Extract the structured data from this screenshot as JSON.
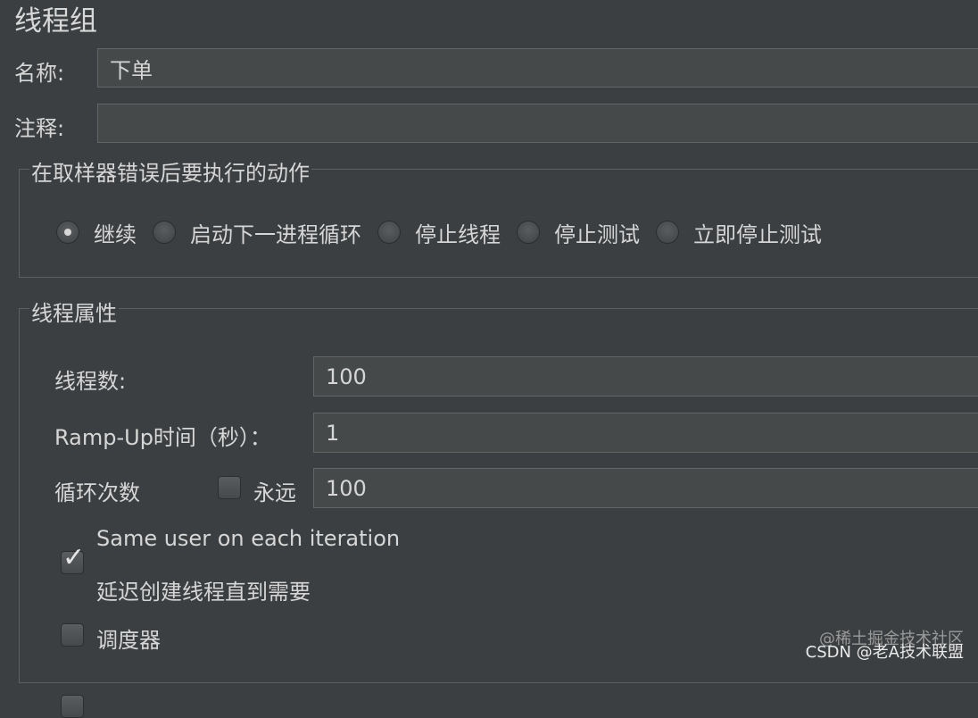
{
  "panel": {
    "title": "线程组",
    "name_label": "名称:",
    "name_value": "下单",
    "comment_label": "注释:",
    "comment_value": ""
  },
  "error_action": {
    "legend": "在取样器错误后要执行的动作",
    "options": [
      {
        "label": "继续",
        "selected": true
      },
      {
        "label": "启动下一进程循环",
        "selected": false
      },
      {
        "label": "停止线程",
        "selected": false
      },
      {
        "label": "停止测试",
        "selected": false
      },
      {
        "label": "立即停止测试",
        "selected": false
      }
    ]
  },
  "thread_props": {
    "legend": "线程属性",
    "threads_label": "线程数:",
    "threads_value": "100",
    "rampup_label": "Ramp-Up时间（秒）：",
    "rampup_value": "1",
    "loop_label": "循环次数",
    "forever_label": "永远",
    "forever_checked": false,
    "loop_value": "100",
    "same_user_label": "Same user on each iteration",
    "same_user_checked": true,
    "delay_label": "延迟创建线程直到需要",
    "delay_checked": false,
    "scheduler_label": "调度器",
    "scheduler_checked": false
  },
  "watermark": {
    "line1": "@稀土掘金技术社区",
    "line2": "CSDN @老A技术联盟"
  }
}
